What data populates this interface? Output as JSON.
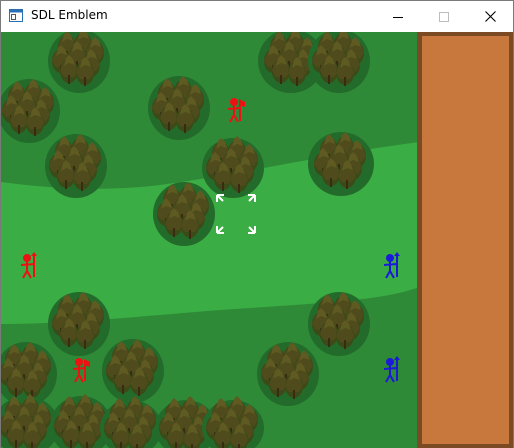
{
  "window": {
    "title": "SDL Emblem",
    "controls": {
      "minimize_icon": "minimize-icon",
      "maximize_icon": "maximize-icon",
      "close_icon": "close-icon"
    }
  },
  "game": {
    "colors": {
      "grass_dark": "#2f8a38",
      "grass_light": "#3bad45",
      "road": "#c8783c",
      "road_edge": "#7a4a24",
      "tree_shadow": "#236b2a",
      "tree_canopy": "#4a4a1e",
      "tree_trunk": "#3a2a14",
      "red_unit": "#ee1111",
      "blue_unit": "#1a1ad8",
      "cursor": "#ffffff"
    },
    "units": [
      {
        "team": "red",
        "weapon": "axe"
      },
      {
        "team": "red",
        "weapon": "lance"
      },
      {
        "team": "red",
        "weapon": "axe"
      },
      {
        "team": "blue",
        "weapon": "lance"
      },
      {
        "team": "blue",
        "weapon": "lance"
      }
    ],
    "cursor_icon": "selection-cursor-icon"
  }
}
